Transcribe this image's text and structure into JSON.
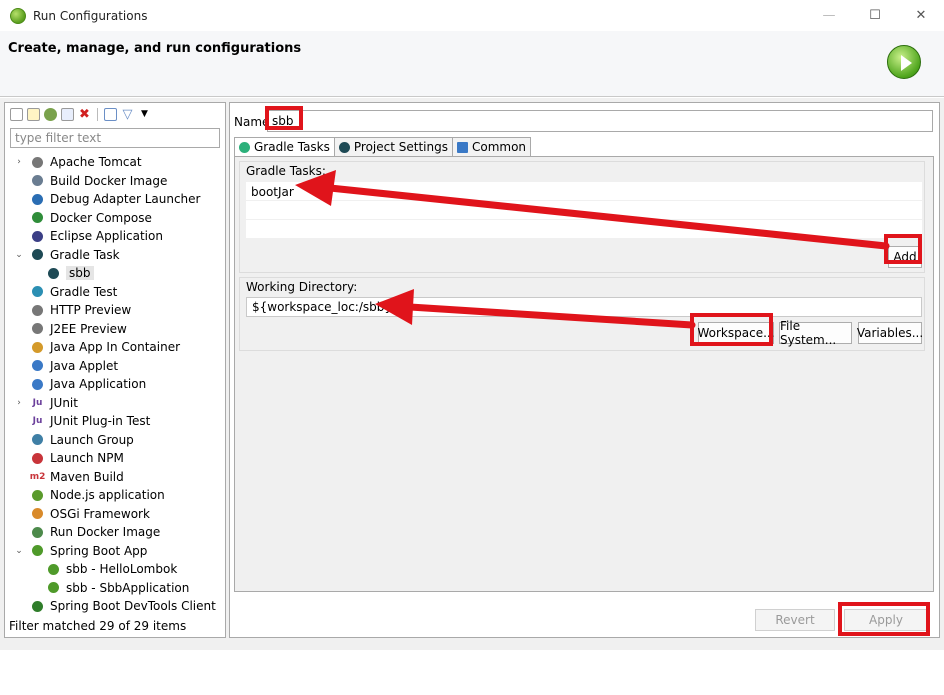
{
  "window": {
    "title": "Run Configurations",
    "minimize": "—",
    "maximize": "☐",
    "close": "✕"
  },
  "banner": {
    "title": "Create, manage, and run configurations"
  },
  "sidebar": {
    "filter_placeholder": "type filter text",
    "status": "Filter matched 29 of 29 items",
    "items": [
      {
        "label": "Apache Tomcat",
        "twisty": "›",
        "icon": "tomcat-icon",
        "color": "#777777"
      },
      {
        "label": "Build Docker Image",
        "twisty": "",
        "icon": "docker-build-icon",
        "color": "#6a7d91"
      },
      {
        "label": "Debug Adapter Launcher",
        "twisty": "",
        "icon": "debug-adapter-icon",
        "color": "#2a6db3"
      },
      {
        "label": "Docker Compose",
        "twisty": "",
        "icon": "docker-compose-icon",
        "color": "#2f8d3a"
      },
      {
        "label": "Eclipse Application",
        "twisty": "",
        "icon": "eclipse-icon",
        "color": "#3b3f86"
      },
      {
        "label": "Gradle Task",
        "twisty": "⌄",
        "icon": "gradle-icon",
        "color": "#1e4a55"
      },
      {
        "label": "sbb",
        "twisty": "",
        "icon": "gradle-icon",
        "color": "#1e4a55",
        "child": true,
        "selected": true
      },
      {
        "label": "Gradle Test",
        "twisty": "",
        "icon": "gradle-test-icon",
        "color": "#2b8fb3"
      },
      {
        "label": "HTTP Preview",
        "twisty": "",
        "icon": "http-preview-icon",
        "color": "#777777"
      },
      {
        "label": "J2EE Preview",
        "twisty": "",
        "icon": "j2ee-preview-icon",
        "color": "#777777"
      },
      {
        "label": "Java App In Container",
        "twisty": "",
        "icon": "java-container-icon",
        "color": "#d49a2a"
      },
      {
        "label": "Java Applet",
        "twisty": "",
        "icon": "java-applet-icon",
        "color": "#3a79c6"
      },
      {
        "label": "Java Application",
        "twisty": "",
        "icon": "java-application-icon",
        "color": "#3a79c6"
      },
      {
        "label": "JUnit",
        "twisty": "›",
        "icon": "junit-icon",
        "color": "#6b3f9b",
        "glyph": "Ju"
      },
      {
        "label": "JUnit Plug-in Test",
        "twisty": "",
        "icon": "junit-plugin-icon",
        "color": "#6b3f9b",
        "glyph": "Ju"
      },
      {
        "label": "Launch Group",
        "twisty": "",
        "icon": "launch-group-icon",
        "color": "#3f7fa5"
      },
      {
        "label": "Launch NPM",
        "twisty": "",
        "icon": "npm-icon",
        "color": "#c8343a"
      },
      {
        "label": "Maven Build",
        "twisty": "",
        "icon": "maven-icon",
        "color": "#c8343a",
        "glyph": "m2"
      },
      {
        "label": "Node.js application",
        "twisty": "",
        "icon": "nodejs-icon",
        "color": "#5a9a2c"
      },
      {
        "label": "OSGi Framework",
        "twisty": "",
        "icon": "osgi-icon",
        "color": "#d98a2a"
      },
      {
        "label": "Run Docker Image",
        "twisty": "",
        "icon": "docker-run-icon",
        "color": "#4d8a4b"
      },
      {
        "label": "Spring Boot App",
        "twisty": "⌄",
        "icon": "spring-boot-icon",
        "color": "#4f9a2a"
      },
      {
        "label": "sbb - HelloLombok",
        "twisty": "",
        "icon": "spring-boot-icon",
        "color": "#4f9a2a",
        "child": true
      },
      {
        "label": "sbb - SbbApplication",
        "twisty": "",
        "icon": "spring-boot-icon",
        "color": "#4f9a2a",
        "child": true
      },
      {
        "label": "Spring Boot DevTools Client",
        "twisty": "",
        "icon": "spring-devtools-icon",
        "color": "#2f7d2a"
      }
    ]
  },
  "main": {
    "name_label": "Name:",
    "name_value": "sbb",
    "tabs": [
      {
        "label": "Gradle Tasks",
        "icon": "gradle-tasks-icon",
        "color": "#2bb07a",
        "active": true
      },
      {
        "label": "Project Settings",
        "icon": "gradle-icon",
        "color": "#1e4a55"
      },
      {
        "label": "Common",
        "icon": "common-icon",
        "color": "#3a79c6"
      }
    ],
    "gradle_tasks": {
      "label": "Gradle Tasks:",
      "rows": [
        "bootJar",
        "",
        ""
      ],
      "add_button": "Add"
    },
    "working_dir": {
      "label": "Working Directory:",
      "value": "${workspace_loc:/sbb}",
      "buttons": {
        "workspace": "Workspace...",
        "file_system": "File System...",
        "variables": "Variables..."
      }
    },
    "revert_button": "Revert",
    "apply_button": "Apply"
  },
  "annotation_color": "#e0141b"
}
